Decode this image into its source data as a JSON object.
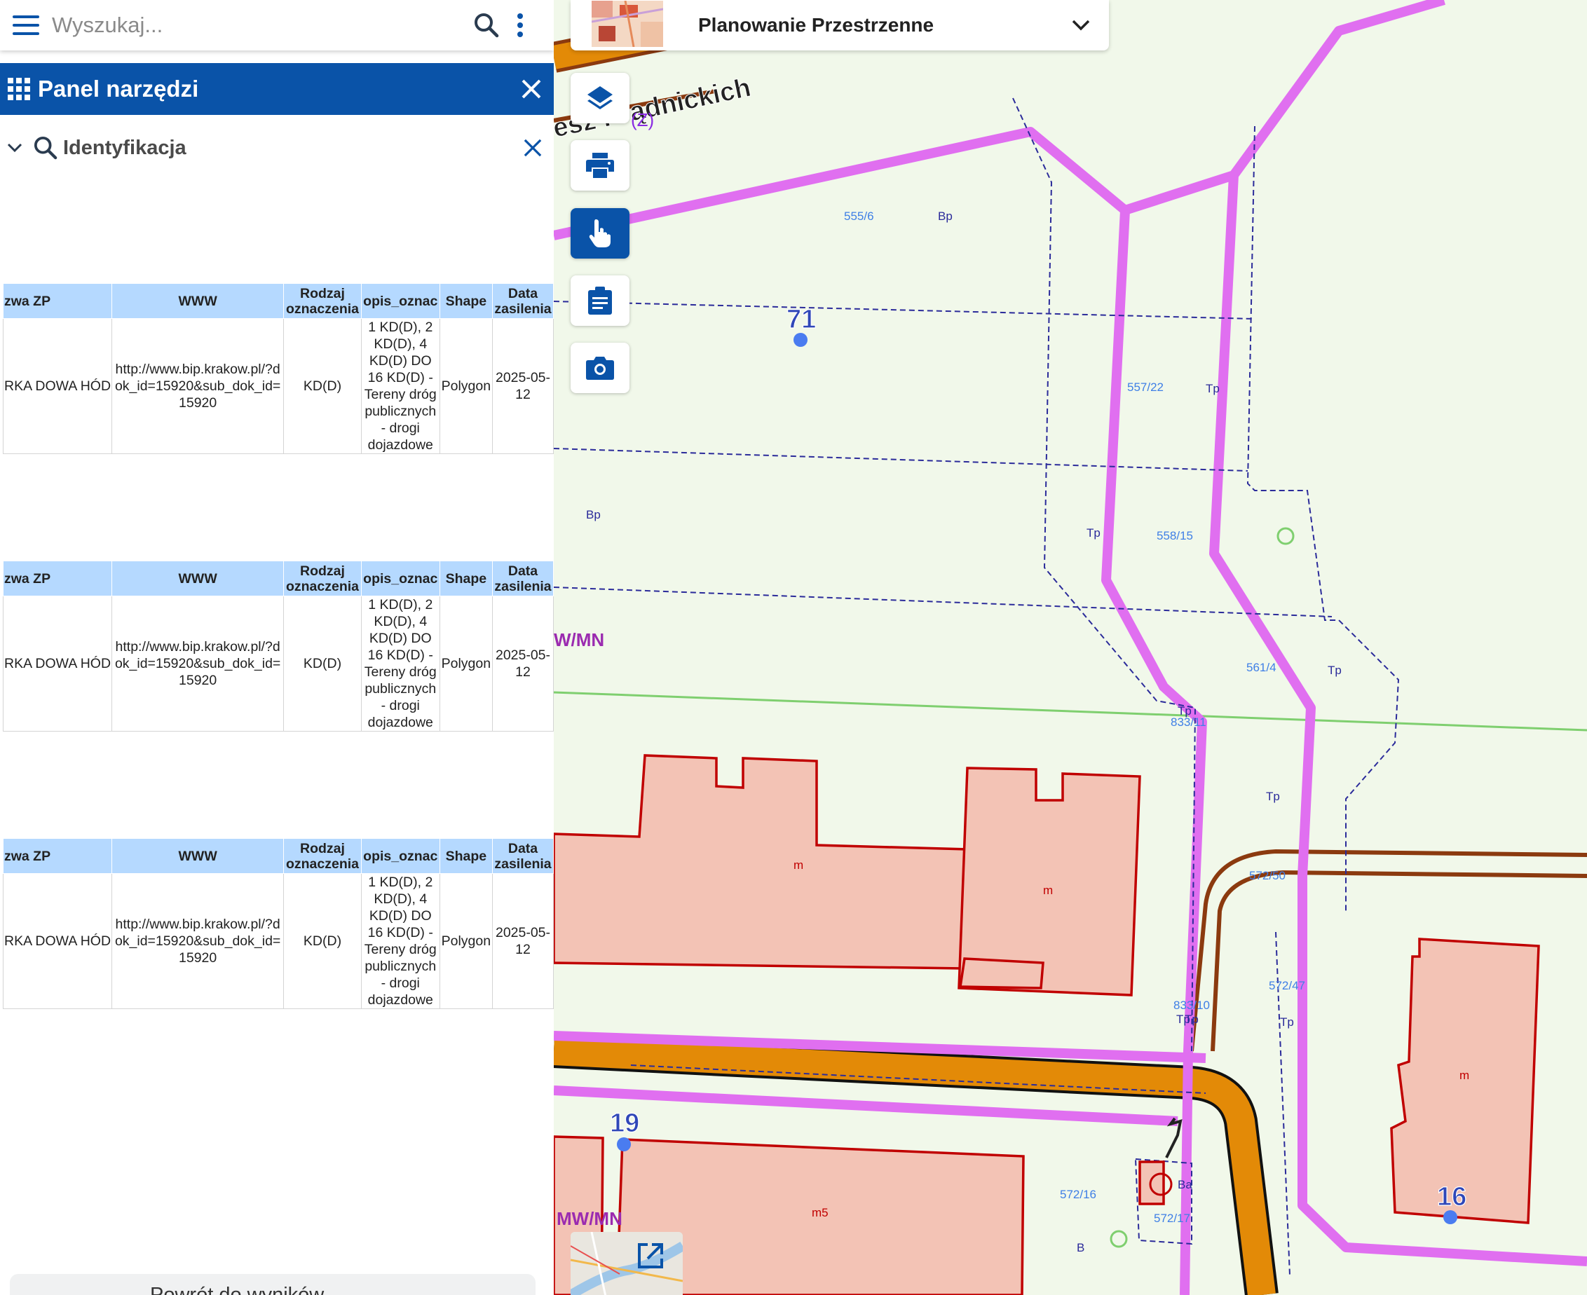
{
  "search": {
    "placeholder": "Wyszukaj..."
  },
  "theme": {
    "title": "Planowanie Przestrzenne"
  },
  "tools_panel": {
    "title": "Panel narzędzi"
  },
  "identify": {
    "title": "Identyfikacja"
  },
  "table": {
    "headers": [
      "zwa ZP",
      "WWW",
      "Rodzaj oznaczenia",
      "opis_oznac",
      "Shape",
      "Data zasilenia"
    ],
    "rows": [
      {
        "name": "RKA DOWA HÓD",
        "www": "http://www.bip.krakow.pl/?dok_id=15920&sub_dok_id=15920",
        "rodzaj": "KD(D)",
        "opis": "1 KD(D), 2 KD(D), 4 KD(D) DO 16 KD(D) - Tereny dróg publicznych - drogi dojazdowe",
        "shape": "Polygon",
        "data": "2025-05-12"
      },
      {
        "name": "RKA DOWA HÓD",
        "www": "http://www.bip.krakow.pl/?dok_id=15920&sub_dok_id=15920",
        "rodzaj": "KD(D)",
        "opis": "1 KD(D), 2 KD(D), 4 KD(D) DO 16 KD(D) - Tereny dróg publicznych - drogi dojazdowe",
        "shape": "Polygon",
        "data": "2025-05-12"
      },
      {
        "name": "RKA DOWA HÓD",
        "www": "http://www.bip.krakow.pl/?dok_id=15920&sub_dok_id=15920",
        "rodzaj": "KD(D)",
        "opis": "1 KD(D), 2 KD(D), 4 KD(D) DO 16 KD(D) - Tereny dróg publicznych - drogi dojazdowe",
        "shape": "Polygon",
        "data": "2025-05-12"
      }
    ]
  },
  "bottom_button": {
    "label": "Powrót do wyników"
  },
  "map": {
    "street_label": "esz Prądnickich",
    "street_suffix": "(Z)",
    "zone_labels": [
      "W/MN",
      "MW/MN"
    ],
    "point_labels": [
      "71",
      "19",
      "16"
    ],
    "parcel_labels": [
      "555/6",
      "557/22",
      "558/15",
      "561/4",
      "833/11",
      "572/50",
      "572/47",
      "833/10",
      "572/16",
      "572/17"
    ],
    "use_labels": [
      "Bp",
      "Bp",
      "Tp",
      "Tp",
      "Tp",
      "Tp",
      "Tp",
      "Tp",
      "Tp",
      "Tp",
      "Ba",
      "B"
    ],
    "building_labels": [
      "m",
      "m",
      "m",
      "m5"
    ],
    "colors": {
      "background": "#f1f8ea",
      "road": "#e38a07",
      "boundary": "#e06ff0",
      "building": "#f3c3b5",
      "building_edge": "#c00000",
      "parcel_line": "#2b2b9a",
      "accent": "#0a53a8"
    }
  },
  "icons": [
    "menu-icon",
    "search-icon",
    "more-vert-icon",
    "apps-grid-icon",
    "close-icon",
    "chevron-down-icon",
    "layers-icon",
    "printer-icon",
    "touch-icon",
    "clipboard-icon",
    "camera-icon",
    "open-external-icon"
  ]
}
